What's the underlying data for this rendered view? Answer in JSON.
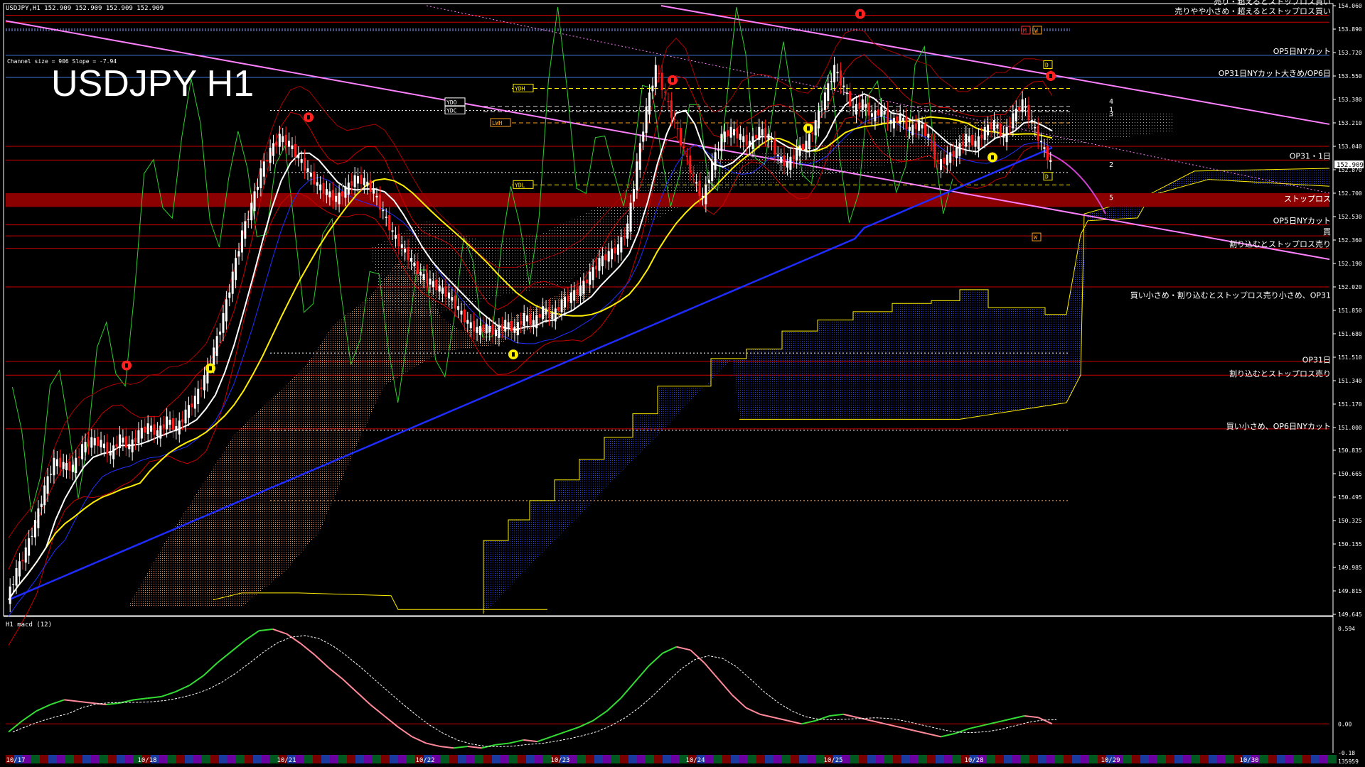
{
  "window": {
    "header": "USDJPY,H1  152.909 152.909 152.909 152.909",
    "channel_info": "Channel size = 906 Slope = -7.94",
    "main_title": "USDJPY H1",
    "macd_header": "H1  macd (12)"
  },
  "colors": {
    "background": "#000000",
    "candle_up": "#ffffff",
    "candle_down": "#ff1a1a",
    "ma_white": "#ffffff",
    "ma_yellow": "#ffee00",
    "ma_blue": "#1f2cff",
    "chikou": "#2ecc2e",
    "channel": "#ff80ff",
    "grid_red": "#cc0000",
    "grid_blue": "#3c78d8",
    "cloud_blue": "#2d3fd6",
    "cloud_orange": "#e08a50",
    "stop_band": "#8b0000",
    "macd_green": "#33dd33",
    "macd_pink": "#ff8899",
    "macd_signal": "#ffffff"
  },
  "price_axis": {
    "ticks": [
      "154.060",
      "153.890",
      "153.720",
      "153.550",
      "153.380",
      "153.210",
      "153.040",
      "152.870",
      "152.700",
      "152.530",
      "152.360",
      "152.190",
      "152.020",
      "151.850",
      "151.680",
      "151.510",
      "151.340",
      "151.170",
      "151.000",
      "150.835",
      "150.665",
      "150.495",
      "150.325",
      "150.155",
      "149.985",
      "149.815",
      "149.645"
    ],
    "current_price": "152.909"
  },
  "macd_axis": {
    "ticks": [
      "0.594",
      "0.00",
      "-0.18",
      "135959"
    ]
  },
  "time_axis": {
    "labels": [
      "10/17",
      "10/18",
      "10/21",
      "10/22",
      "10/23",
      "10/24",
      "10/25",
      "10/28",
      "10/29",
      "10/30"
    ]
  },
  "level_labels": [
    {
      "text": "売り・超えるとストップロス買い",
      "price": 154.06
    },
    {
      "text": "売りやや小さめ・超えるとストップロス買い",
      "price": 153.99
    },
    {
      "text": "OP5日NYカット",
      "price": 153.7
    },
    {
      "text": "OP31日NYカット大きめ/OP6日",
      "price": 153.54
    },
    {
      "text": "OP31・1日",
      "price": 152.94
    },
    {
      "text": "ストップロス",
      "price": 152.63
    },
    {
      "text": "OP5日NYカット",
      "price": 152.47
    },
    {
      "text": "買",
      "price": 152.39
    },
    {
      "text": "割り込むとストップロス売り",
      "price": 152.3
    },
    {
      "text": "買い小さめ・割り込むとストップロス売り小さめ、OP31",
      "price": 151.93
    },
    {
      "text": "OP31日",
      "price": 151.46
    },
    {
      "text": "割り込むとストップロス売り",
      "price": 151.36
    },
    {
      "text": "買い小さめ、OP6日NYカット",
      "price": 150.98
    }
  ],
  "box_labels": [
    "YDH",
    "YDO",
    "YDC",
    "LWH",
    "YDL",
    "M",
    "W",
    "D",
    "D",
    "W"
  ],
  "wave_labels": [
    "1",
    "2",
    "3",
    "4",
    "5"
  ],
  "chart_data": {
    "type": "candlestick",
    "title": "USDJPY H1",
    "symbol": "USDJPY",
    "timeframe": "H1",
    "ylim": [
      149.645,
      154.06
    ],
    "macd_ylim": [
      -0.18,
      0.594
    ],
    "x_dates": [
      "10/17",
      "10/18",
      "10/21",
      "10/22",
      "10/23",
      "10/24",
      "10/25",
      "10/28",
      "10/29",
      "10/30"
    ],
    "close_path": [
      149.75,
      149.95,
      150.1,
      150.3,
      150.55,
      150.75,
      150.72,
      150.7,
      150.85,
      150.9,
      150.88,
      150.8,
      150.92,
      150.85,
      150.95,
      151.0,
      150.95,
      151.05,
      150.98,
      151.1,
      151.2,
      151.35,
      151.55,
      151.8,
      152.1,
      152.4,
      152.6,
      152.85,
      153.0,
      153.1,
      153.05,
      152.95,
      152.85,
      152.75,
      152.7,
      152.65,
      152.72,
      152.8,
      152.78,
      152.7,
      152.55,
      152.4,
      152.3,
      152.2,
      152.1,
      152.05,
      152.0,
      151.95,
      151.85,
      151.75,
      151.7,
      151.72,
      151.68,
      151.75,
      151.7,
      151.8,
      151.75,
      151.85,
      151.8,
      151.9,
      151.95,
      152.0,
      152.1,
      152.2,
      152.25,
      152.3,
      152.45,
      152.9,
      153.3,
      153.6,
      153.4,
      153.2,
      153.0,
      152.8,
      152.65,
      152.9,
      153.1,
      153.15,
      153.1,
      153.05,
      153.15,
      153.1,
      152.95,
      152.9,
      153.0,
      153.05,
      153.2,
      153.4,
      153.6,
      153.45,
      153.3,
      153.35,
      153.25,
      153.3,
      153.2,
      153.25,
      153.15,
      153.2,
      153.1,
      152.9,
      152.95,
      153.0,
      153.1,
      153.05,
      153.15,
      153.2,
      153.1,
      153.25,
      153.35,
      153.2,
      153.05,
      152.91
    ],
    "series": [
      {
        "name": "SMA fast",
        "color": "white"
      },
      {
        "name": "SMA medium",
        "color": "yellow"
      },
      {
        "name": "SMA slow",
        "color": "blue"
      },
      {
        "name": "Chikou span",
        "color": "green"
      },
      {
        "name": "MACD main",
        "color": "green/pink"
      },
      {
        "name": "MACD signal",
        "color": "white dotted"
      }
    ],
    "macd_path": [
      -0.05,
      0.02,
      0.08,
      0.12,
      0.15,
      0.14,
      0.13,
      0.12,
      0.13,
      0.15,
      0.16,
      0.17,
      0.2,
      0.24,
      0.3,
      0.38,
      0.45,
      0.52,
      0.58,
      0.59,
      0.56,
      0.5,
      0.43,
      0.35,
      0.28,
      0.2,
      0.12,
      0.05,
      -0.02,
      -0.08,
      -0.12,
      -0.14,
      -0.15,
      -0.14,
      -0.15,
      -0.13,
      -0.12,
      -0.1,
      -0.11,
      -0.08,
      -0.05,
      -0.02,
      0.02,
      0.08,
      0.16,
      0.26,
      0.36,
      0.44,
      0.48,
      0.46,
      0.38,
      0.28,
      0.18,
      0.1,
      0.06,
      0.04,
      0.02,
      0.0,
      0.02,
      0.05,
      0.06,
      0.04,
      0.02,
      0.0,
      -0.02,
      -0.04,
      -0.06,
      -0.08,
      -0.06,
      -0.03,
      -0.01,
      0.01,
      0.03,
      0.05,
      0.04,
      0.0
    ]
  }
}
